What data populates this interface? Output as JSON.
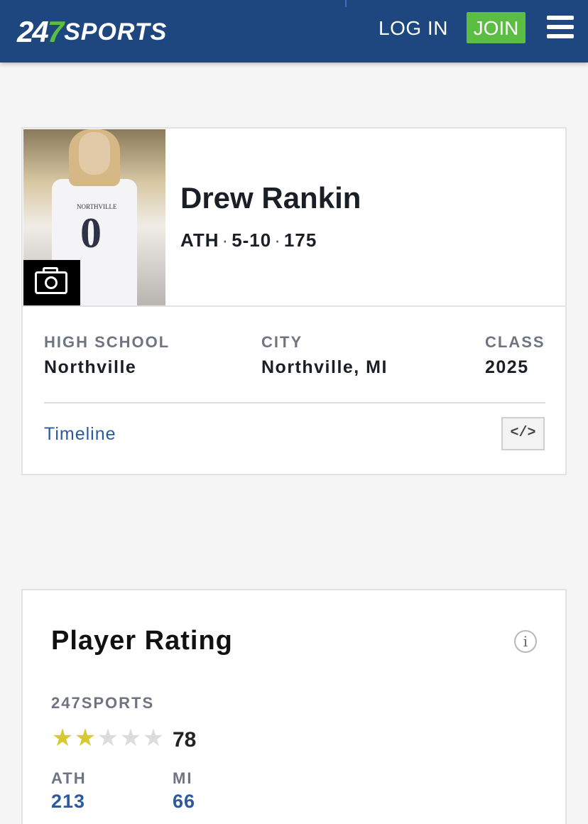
{
  "header": {
    "logo_number": "24",
    "logo_seven": "7",
    "logo_word": "SPORTS",
    "login_label": "LOG IN",
    "join_label": "JOIN",
    "menu_icon": "hamburger-menu-icon"
  },
  "player": {
    "name": "Drew Rankin",
    "position": "ATH",
    "height": "5-10",
    "weight": "175",
    "jersey_text": "NORTHVILLE",
    "jersey_number": "0",
    "camera_icon": "camera-icon"
  },
  "details": [
    {
      "label": "HIGH SCHOOL",
      "value": "Northville"
    },
    {
      "label": "CITY",
      "value": "Northville, MI"
    },
    {
      "label": "CLASS",
      "value": "2025"
    }
  ],
  "timeline_label": "Timeline",
  "embed_label": "</>",
  "rating": {
    "title": "Player Rating",
    "info_label": "i",
    "source": "247SPORTS",
    "stars_filled": 2,
    "stars_total": 5,
    "score": "78",
    "ranks": [
      {
        "label": "ATH",
        "value": "213"
      },
      {
        "label": "MI",
        "value": "66"
      }
    ]
  },
  "colors": {
    "header_bg": "#1e4780",
    "brand_green": "#5cbd43",
    "link_blue": "#2c5aa0",
    "star_gold": "#d8c92c"
  }
}
